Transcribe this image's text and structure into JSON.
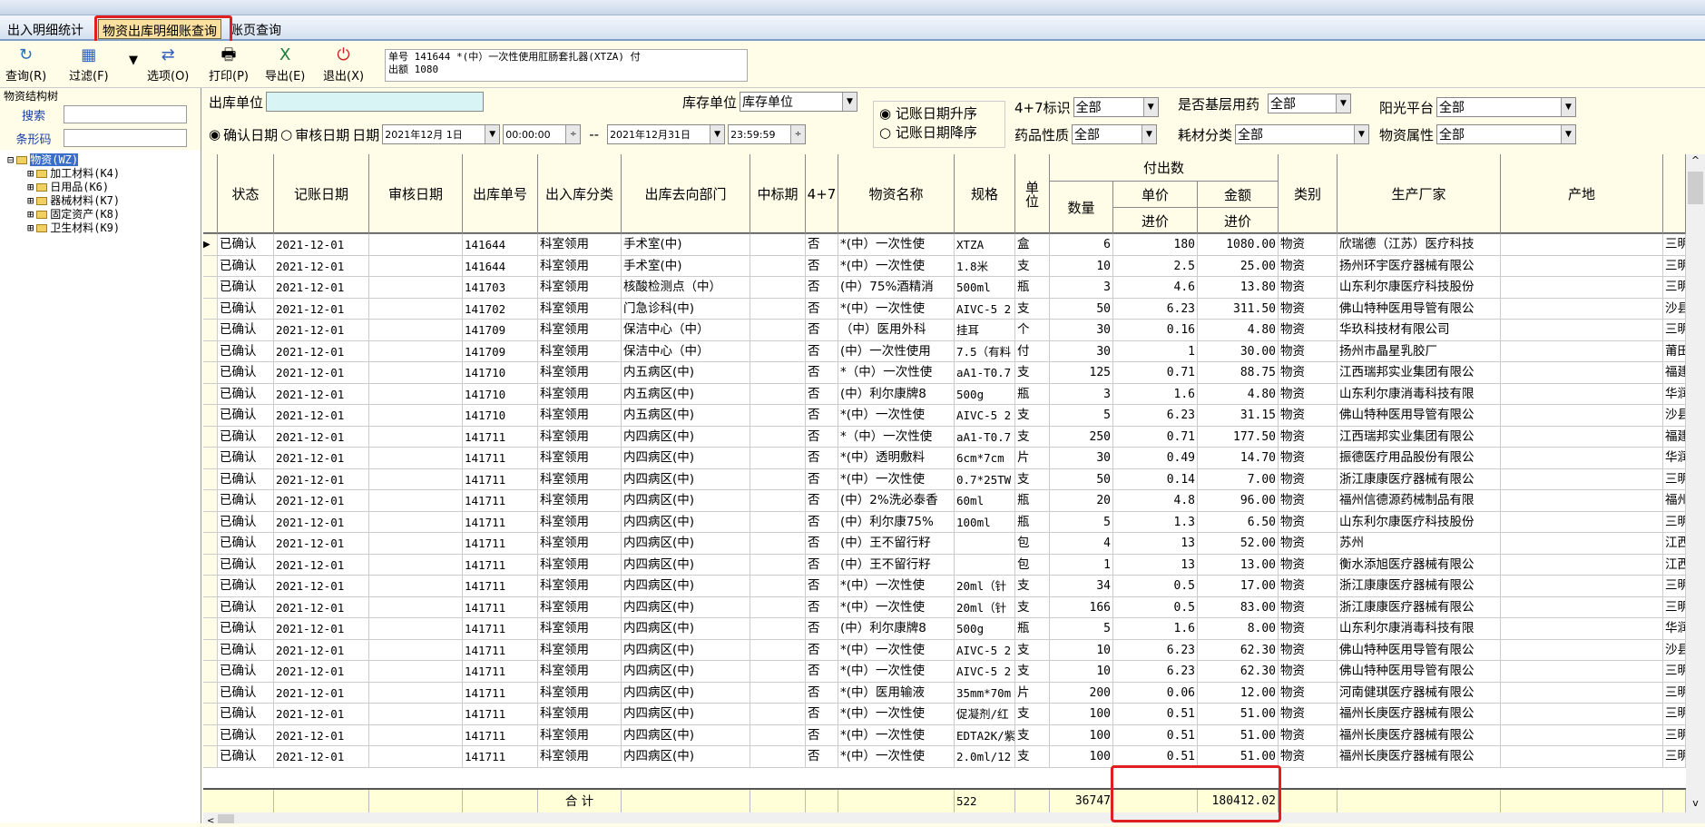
{
  "top_strip": "",
  "tabs": [
    {
      "label": "出入明细统计"
    },
    {
      "label": "物资出库明细账查询",
      "active": true
    },
    {
      "label": "账页查询"
    }
  ],
  "toolbar": {
    "query": "查询(R)",
    "filter": "过滤(F)",
    "options": "选项(O)",
    "print": "打印(P)",
    "export": "导出(E)",
    "exit": "退出(X)"
  },
  "info": {
    "line1": "单号 141644  *(中）一次性使用肛肠套扎器(XTZA) 付",
    "line2": "出额 1080"
  },
  "left": {
    "title": "物资结构树",
    "search_label": "搜索",
    "barcode_label": "条形码",
    "tree": [
      {
        "label": "物资(WZ)",
        "root": true
      },
      {
        "label": "加工材料(K4)"
      },
      {
        "label": "日用品(K6)"
      },
      {
        "label": "器械材料(K7)"
      },
      {
        "label": "固定资产(K8)"
      },
      {
        "label": "卫生材料(K9)"
      }
    ]
  },
  "filters": {
    "out_unit_label": "出库单位",
    "out_unit_value": "",
    "stock_unit_label": "库存单位",
    "stock_unit_value": "库存单位",
    "confirm_date": "确认日期",
    "audit_date": "审核日期",
    "date_label": "日期",
    "date_from": "2021年12月 1日",
    "time_from": "00:00:00",
    "sep": "--",
    "date_to": "2021年12月31日",
    "time_to": "23:59:59",
    "sort_asc": "记账日期升序",
    "sort_desc": "记账日期降序",
    "flag47_label": "4+7标识",
    "flag47_value": "全部",
    "basic_label": "是否基层用药",
    "basic_value": "全部",
    "sun_label": "阳光平台",
    "sun_value": "全部",
    "drug_label": "药品性质",
    "drug_value": "全部",
    "consum_label": "耗材分类",
    "consum_value": "全部",
    "attr_label": "物资属性",
    "attr_value": "全部"
  },
  "headers": {
    "status": "状态",
    "book_date": "记账日期",
    "audit_date": "审核日期",
    "out_no": "出库单号",
    "category": "出入库分类",
    "dept": "出库去向部门",
    "bid": "中标期",
    "f47": "4+7",
    "name": "物资名称",
    "spec": "规格",
    "unit": "单位",
    "paid": "付出数",
    "qty": "数量",
    "price": "单价",
    "amount": "金额",
    "in_price": "进价",
    "in_price2": "进价",
    "type": "类别",
    "maker": "生产厂家",
    "origin": "产地"
  },
  "rows": [
    [
      "已确认",
      "2021-12-01",
      "",
      "141644",
      "科室领用",
      "手术室(中)",
      "",
      "否",
      "*(中）一次性使",
      "XTZA",
      "盒",
      "6",
      "180",
      "1080.00",
      "物资",
      "欣瑞德（江苏）医疗科技",
      "",
      "三明"
    ],
    [
      "已确认",
      "2021-12-01",
      "",
      "141644",
      "科室领用",
      "手术室(中)",
      "",
      "否",
      "*(中）一次性使",
      "1.8米",
      "支",
      "10",
      "2.5",
      "25.00",
      "物资",
      "扬州环宇医疗器械有限公",
      "",
      "三明"
    ],
    [
      "已确认",
      "2021-12-01",
      "",
      "141703",
      "科室领用",
      "核酸检测点（中）",
      "",
      "否",
      "(中）75%酒精消",
      "500ml",
      "瓶",
      "3",
      "4.6",
      "13.80",
      "物资",
      "山东利尔康医疗科技股份",
      "",
      "三明"
    ],
    [
      "已确认",
      "2021-12-01",
      "",
      "141702",
      "科室领用",
      "门急诊科(中)",
      "",
      "否",
      "*(中）一次性使",
      "AIVC-5 2",
      "支",
      "50",
      "6.23",
      "311.50",
      "物资",
      "佛山特种医用导管有限公",
      "",
      "沙县"
    ],
    [
      "已确认",
      "2021-12-01",
      "",
      "141709",
      "科室领用",
      "保洁中心（中）",
      "",
      "否",
      "（中）医用外科",
      "挂耳",
      "个",
      "30",
      "0.16",
      "4.80",
      "物资",
      "华玖科技材有限公司",
      "",
      "三明"
    ],
    [
      "已确认",
      "2021-12-01",
      "",
      "141709",
      "科室领用",
      "保洁中心（中）",
      "",
      "否",
      "(中）一次性使用",
      "7.5（有料",
      "付",
      "30",
      "1",
      "30.00",
      "物资",
      "扬州市晶星乳胶厂",
      "",
      "莆田"
    ],
    [
      "已确认",
      "2021-12-01",
      "",
      "141710",
      "科室领用",
      "内五病区(中)",
      "",
      "否",
      "*（中）一次性使",
      "aA1-T0.7",
      "支",
      "125",
      "0.71",
      "88.75",
      "物资",
      "江西瑞邦实业集团有限公",
      "",
      "福建"
    ],
    [
      "已确认",
      "2021-12-01",
      "",
      "141710",
      "科室领用",
      "内五病区(中)",
      "",
      "否",
      "(中）利尔康牌8",
      "500g",
      "瓶",
      "3",
      "1.6",
      "4.80",
      "物资",
      "山东利尔康消毒科技有限",
      "",
      "华润"
    ],
    [
      "已确认",
      "2021-12-01",
      "",
      "141710",
      "科室领用",
      "内五病区(中)",
      "",
      "否",
      "*(中）一次性使",
      "AIVC-5 2",
      "支",
      "5",
      "6.23",
      "31.15",
      "物资",
      "佛山特种医用导管有限公",
      "",
      "沙县"
    ],
    [
      "已确认",
      "2021-12-01",
      "",
      "141711",
      "科室领用",
      "内四病区(中)",
      "",
      "否",
      "*（中）一次性使",
      "aA1-T0.7",
      "支",
      "250",
      "0.71",
      "177.50",
      "物资",
      "江西瑞邦实业集团有限公",
      "",
      "福建"
    ],
    [
      "已确认",
      "2021-12-01",
      "",
      "141711",
      "科室领用",
      "内四病区(中)",
      "",
      "否",
      "*(中）透明敷料",
      "6cm*7cm",
      "片",
      "30",
      "0.49",
      "14.70",
      "物资",
      "振德医疗用品股份有限公",
      "",
      "华润"
    ],
    [
      "已确认",
      "2021-12-01",
      "",
      "141711",
      "科室领用",
      "内四病区(中)",
      "",
      "否",
      "*(中）一次性使",
      "0.7*25TW",
      "支",
      "50",
      "0.14",
      "7.00",
      "物资",
      "浙江康康医疗器械有限公",
      "",
      "三明"
    ],
    [
      "已确认",
      "2021-12-01",
      "",
      "141711",
      "科室领用",
      "内四病区(中)",
      "",
      "否",
      "(中）2%洗必泰香",
      "60ml",
      "瓶",
      "20",
      "4.8",
      "96.00",
      "物资",
      "福州信德源药械制品有限",
      "",
      "福州"
    ],
    [
      "已确认",
      "2021-12-01",
      "",
      "141711",
      "科室领用",
      "内四病区(中)",
      "",
      "否",
      "(中）利尔康75%",
      "100ml",
      "瓶",
      "5",
      "1.3",
      "6.50",
      "物资",
      "山东利尔康医疗科技股份",
      "",
      "三明"
    ],
    [
      "已确认",
      "2021-12-01",
      "",
      "141711",
      "科室领用",
      "内四病区(中)",
      "",
      "否",
      "(中）王不留行籽",
      "",
      "包",
      "4",
      "13",
      "52.00",
      "物资",
      "苏州",
      "",
      "江西"
    ],
    [
      "已确认",
      "2021-12-01",
      "",
      "141711",
      "科室领用",
      "内四病区(中)",
      "",
      "否",
      "(中）王不留行籽",
      "",
      "包",
      "1",
      "13",
      "13.00",
      "物资",
      "衡水添旭医疗器械有限公",
      "",
      "江西"
    ],
    [
      "已确认",
      "2021-12-01",
      "",
      "141711",
      "科室领用",
      "内四病区(中)",
      "",
      "否",
      "*(中）一次性使",
      "20ml（针",
      "支",
      "34",
      "0.5",
      "17.00",
      "物资",
      "浙江康康医疗器械有限公",
      "",
      "三明"
    ],
    [
      "已确认",
      "2021-12-01",
      "",
      "141711",
      "科室领用",
      "内四病区(中)",
      "",
      "否",
      "*(中）一次性使",
      "20ml（针",
      "支",
      "166",
      "0.5",
      "83.00",
      "物资",
      "浙江康康医疗器械有限公",
      "",
      "三明"
    ],
    [
      "已确认",
      "2021-12-01",
      "",
      "141711",
      "科室领用",
      "内四病区(中)",
      "",
      "否",
      "(中）利尔康牌8",
      "500g",
      "瓶",
      "5",
      "1.6",
      "8.00",
      "物资",
      "山东利尔康消毒科技有限",
      "",
      "华润"
    ],
    [
      "已确认",
      "2021-12-01",
      "",
      "141711",
      "科室领用",
      "内四病区(中)",
      "",
      "否",
      "*(中）一次性使",
      "AIVC-5 2",
      "支",
      "10",
      "6.23",
      "62.30",
      "物资",
      "佛山特种医用导管有限公",
      "",
      "沙县"
    ],
    [
      "已确认",
      "2021-12-01",
      "",
      "141711",
      "科室领用",
      "内四病区(中)",
      "",
      "否",
      "*(中）一次性使",
      "AIVC-5 2",
      "支",
      "10",
      "6.23",
      "62.30",
      "物资",
      "佛山特种医用导管有限公",
      "",
      "三明"
    ],
    [
      "已确认",
      "2021-12-01",
      "",
      "141711",
      "科室领用",
      "内四病区(中)",
      "",
      "否",
      "*(中）医用输液",
      "35mm*70m",
      "片",
      "200",
      "0.06",
      "12.00",
      "物资",
      "河南健琪医疗器械有限公",
      "",
      "三明"
    ],
    [
      "已确认",
      "2021-12-01",
      "",
      "141711",
      "科室领用",
      "内四病区(中)",
      "",
      "否",
      "*(中）一次性使",
      "促凝剂/红",
      "支",
      "100",
      "0.51",
      "51.00",
      "物资",
      "福州长庚医疗器械有限公",
      "",
      "三明"
    ],
    [
      "已确认",
      "2021-12-01",
      "",
      "141711",
      "科室领用",
      "内四病区(中)",
      "",
      "否",
      "*(中）一次性使",
      "EDTA2K/紫",
      "支",
      "100",
      "0.51",
      "51.00",
      "物资",
      "福州长庚医疗器械有限公",
      "",
      "三明"
    ],
    [
      "已确认",
      "2021-12-01",
      "",
      "141711",
      "科室领用",
      "内四病区(中)",
      "",
      "否",
      "*(中）一次性使",
      "2.0ml/12",
      "支",
      "100",
      "0.51",
      "51.00",
      "物资",
      "福州长庚医疗器械有限公",
      "",
      "三明"
    ]
  ],
  "total": {
    "label": "合  计",
    "spec": "522",
    "qty": "36747",
    "amount": "180412.02"
  }
}
